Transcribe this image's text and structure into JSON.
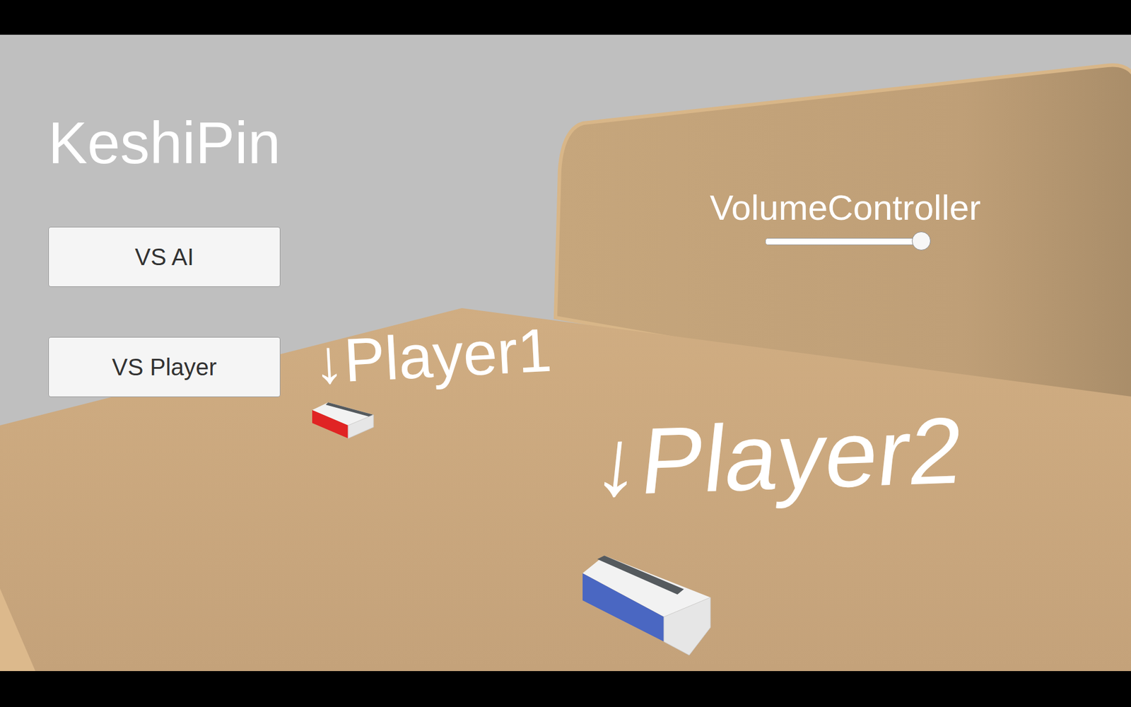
{
  "title": "KeshiPin",
  "menu": [
    {
      "label": "VS AI"
    },
    {
      "label": "VS Player"
    }
  ],
  "volume": {
    "label": "VolumeController",
    "level": 0.94
  },
  "players": [
    {
      "label": "↓Player1",
      "color": "#e02424"
    },
    {
      "label": "↓Player2",
      "color": "#4a67c2"
    }
  ]
}
